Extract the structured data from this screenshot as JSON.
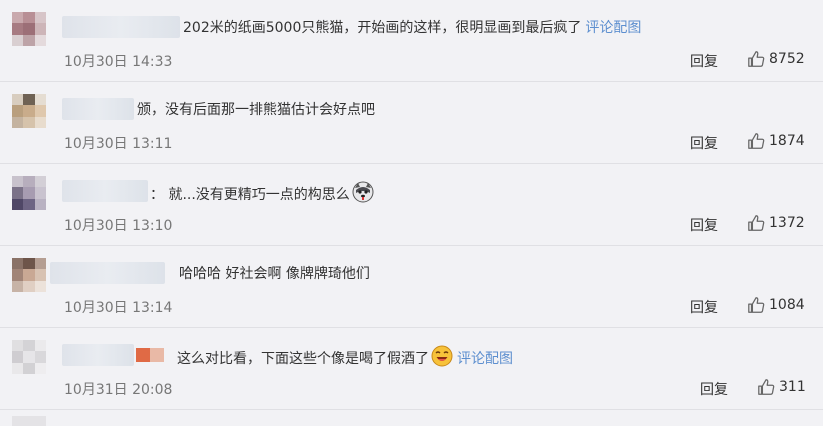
{
  "comments": [
    {
      "text": "202米的纸画5000只熊猫，开始画的这样，很明显画到最后疯了",
      "link": "评论配图",
      "time": "10月30日 14:33",
      "reply": "回复",
      "likes": "8752"
    },
    {
      "text": "颁，没有后面那一排熊猫估计会好点吧",
      "link": "",
      "time": "10月30日 13:11",
      "reply": "回复",
      "likes": "1874"
    },
    {
      "text": "：  就...没有更精巧一点的构思么",
      "link": "",
      "time": "10月30日 13:10",
      "reply": "回复",
      "likes": "1372"
    },
    {
      "text": "哈哈哈  好社会啊  像牌牌琦他们",
      "link": "",
      "time": "10月30日 13:14",
      "reply": "回复",
      "likes": "1084"
    },
    {
      "text": "这么对比看，下面这些个像是喝了假酒了",
      "link": "评论配图",
      "time": "10月31日 20:08",
      "reply": "回复",
      "likes": "311"
    }
  ]
}
